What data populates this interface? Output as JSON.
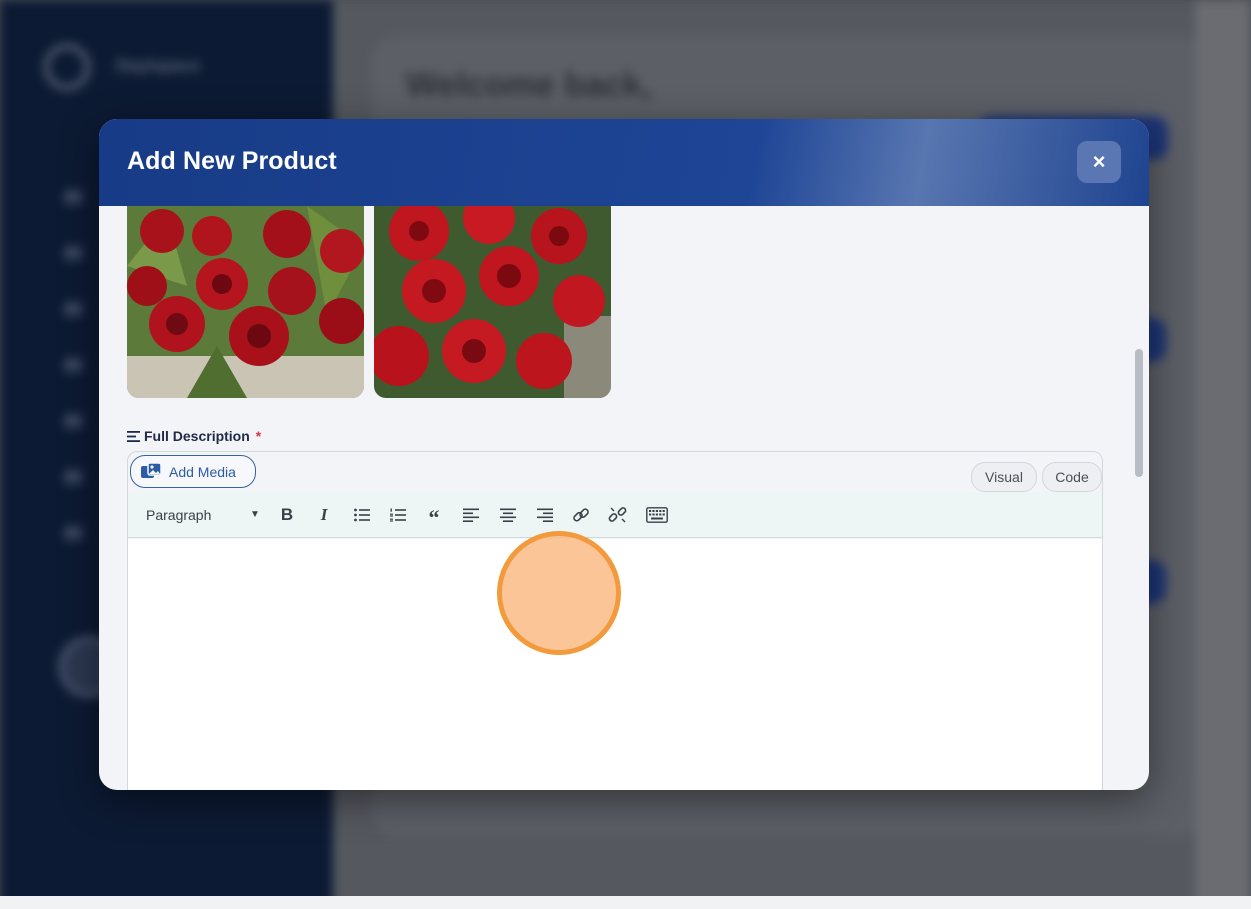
{
  "background": {
    "brand": "Daylspace",
    "welcome": "Welcome back,"
  },
  "modal": {
    "title": "Add New Product",
    "close_icon": "close-icon",
    "close_label": "×"
  },
  "gallery": {
    "images": [
      {
        "name": "red-rose-bouquet-photo"
      },
      {
        "name": "red-roses-photo"
      }
    ]
  },
  "description": {
    "label": "Full Description",
    "required_mark": "*",
    "add_media_label": "Add Media",
    "tabs": {
      "visual": "Visual",
      "code": "Code"
    },
    "format": {
      "selected": "Paragraph",
      "caret": "▼"
    },
    "toolbar": {
      "bold": "B",
      "italic": "I",
      "quote": "“"
    },
    "content": ""
  },
  "colors": {
    "header": "#1e4596",
    "accent": "#2c5ca3",
    "required": "#e0324a",
    "click_ring": "#f29a3c"
  }
}
